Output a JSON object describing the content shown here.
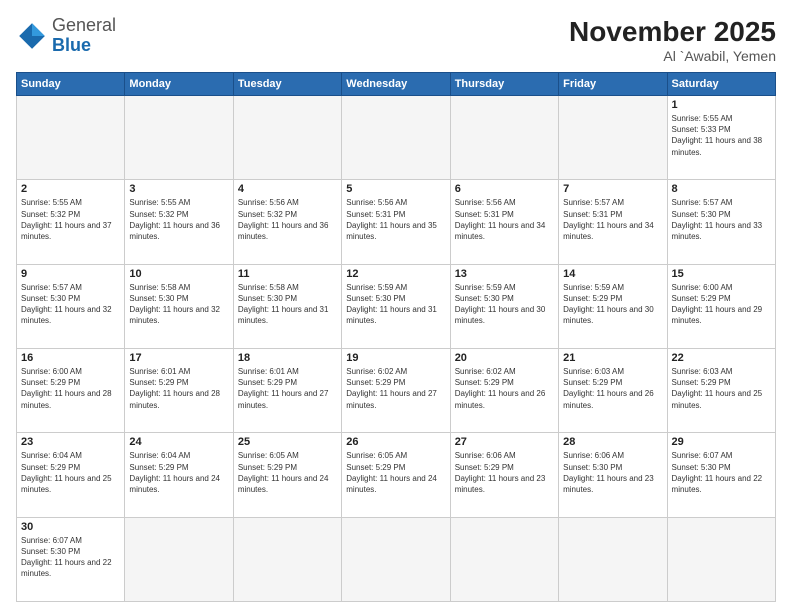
{
  "header": {
    "logo_general": "General",
    "logo_blue": "Blue",
    "month_title": "November 2025",
    "location": "Al `Awabil, Yemen"
  },
  "weekdays": [
    "Sunday",
    "Monday",
    "Tuesday",
    "Wednesday",
    "Thursday",
    "Friday",
    "Saturday"
  ],
  "days": {
    "1": {
      "sunrise": "5:55 AM",
      "sunset": "5:33 PM",
      "daylight": "11 hours and 38 minutes."
    },
    "2": {
      "sunrise": "5:55 AM",
      "sunset": "5:32 PM",
      "daylight": "11 hours and 37 minutes."
    },
    "3": {
      "sunrise": "5:55 AM",
      "sunset": "5:32 PM",
      "daylight": "11 hours and 36 minutes."
    },
    "4": {
      "sunrise": "5:56 AM",
      "sunset": "5:32 PM",
      "daylight": "11 hours and 36 minutes."
    },
    "5": {
      "sunrise": "5:56 AM",
      "sunset": "5:31 PM",
      "daylight": "11 hours and 35 minutes."
    },
    "6": {
      "sunrise": "5:56 AM",
      "sunset": "5:31 PM",
      "daylight": "11 hours and 34 minutes."
    },
    "7": {
      "sunrise": "5:57 AM",
      "sunset": "5:31 PM",
      "daylight": "11 hours and 34 minutes."
    },
    "8": {
      "sunrise": "5:57 AM",
      "sunset": "5:30 PM",
      "daylight": "11 hours and 33 minutes."
    },
    "9": {
      "sunrise": "5:57 AM",
      "sunset": "5:30 PM",
      "daylight": "11 hours and 32 minutes."
    },
    "10": {
      "sunrise": "5:58 AM",
      "sunset": "5:30 PM",
      "daylight": "11 hours and 32 minutes."
    },
    "11": {
      "sunrise": "5:58 AM",
      "sunset": "5:30 PM",
      "daylight": "11 hours and 31 minutes."
    },
    "12": {
      "sunrise": "5:59 AM",
      "sunset": "5:30 PM",
      "daylight": "11 hours and 31 minutes."
    },
    "13": {
      "sunrise": "5:59 AM",
      "sunset": "5:30 PM",
      "daylight": "11 hours and 30 minutes."
    },
    "14": {
      "sunrise": "5:59 AM",
      "sunset": "5:29 PM",
      "daylight": "11 hours and 30 minutes."
    },
    "15": {
      "sunrise": "6:00 AM",
      "sunset": "5:29 PM",
      "daylight": "11 hours and 29 minutes."
    },
    "16": {
      "sunrise": "6:00 AM",
      "sunset": "5:29 PM",
      "daylight": "11 hours and 28 minutes."
    },
    "17": {
      "sunrise": "6:01 AM",
      "sunset": "5:29 PM",
      "daylight": "11 hours and 28 minutes."
    },
    "18": {
      "sunrise": "6:01 AM",
      "sunset": "5:29 PM",
      "daylight": "11 hours and 27 minutes."
    },
    "19": {
      "sunrise": "6:02 AM",
      "sunset": "5:29 PM",
      "daylight": "11 hours and 27 minutes."
    },
    "20": {
      "sunrise": "6:02 AM",
      "sunset": "5:29 PM",
      "daylight": "11 hours and 26 minutes."
    },
    "21": {
      "sunrise": "6:03 AM",
      "sunset": "5:29 PM",
      "daylight": "11 hours and 26 minutes."
    },
    "22": {
      "sunrise": "6:03 AM",
      "sunset": "5:29 PM",
      "daylight": "11 hours and 25 minutes."
    },
    "23": {
      "sunrise": "6:04 AM",
      "sunset": "5:29 PM",
      "daylight": "11 hours and 25 minutes."
    },
    "24": {
      "sunrise": "6:04 AM",
      "sunset": "5:29 PM",
      "daylight": "11 hours and 24 minutes."
    },
    "25": {
      "sunrise": "6:05 AM",
      "sunset": "5:29 PM",
      "daylight": "11 hours and 24 minutes."
    },
    "26": {
      "sunrise": "6:05 AM",
      "sunset": "5:29 PM",
      "daylight": "11 hours and 24 minutes."
    },
    "27": {
      "sunrise": "6:06 AM",
      "sunset": "5:29 PM",
      "daylight": "11 hours and 23 minutes."
    },
    "28": {
      "sunrise": "6:06 AM",
      "sunset": "5:30 PM",
      "daylight": "11 hours and 23 minutes."
    },
    "29": {
      "sunrise": "6:07 AM",
      "sunset": "5:30 PM",
      "daylight": "11 hours and 22 minutes."
    },
    "30": {
      "sunrise": "6:07 AM",
      "sunset": "5:30 PM",
      "daylight": "11 hours and 22 minutes."
    }
  }
}
